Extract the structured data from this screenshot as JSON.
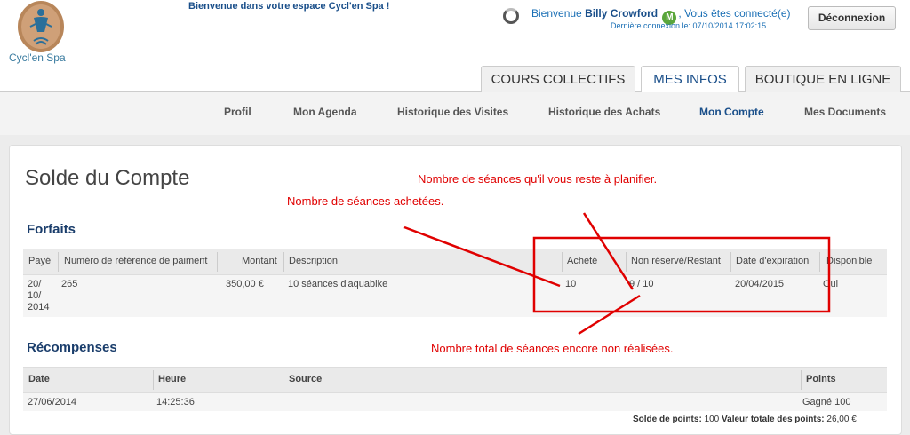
{
  "header": {
    "logo_text": "Cycl'en Spa",
    "welcome_space": "Bienvenue dans votre espace Cycl'en Spa !",
    "welcome_prefix": "Bienvenue",
    "user_name": "Billy Crowford",
    "badge": "M",
    "welcome_suffix": ", Vous êtes connecté(e)",
    "last_login": "Dernière connexion le: 07/10/2014 17:02:15",
    "logout_label": "Déconnexion",
    "tabs": [
      "COURS COLLECTIFS",
      "MES INFOS",
      "BOUTIQUE EN LIGNE"
    ],
    "active_tab": "MES INFOS"
  },
  "subnav": {
    "items": [
      "Profil",
      "Mon Agenda",
      "Historique des Visites",
      "Historique des Achats",
      "Mon Compte",
      "Mes Documents"
    ],
    "active": "Mon Compte"
  },
  "page": {
    "title": "Solde du Compte"
  },
  "forfaits": {
    "title": "Forfaits",
    "columns": [
      "Payé",
      "Numéro de référence de paiment",
      "Montant",
      "Description",
      "Acheté",
      "Non réservé/Restant",
      "Date d'expiration",
      "Disponible"
    ],
    "rows": [
      {
        "paye": "20/ 10/ 2014",
        "paye_lines": [
          "20/",
          "10/",
          "2014"
        ],
        "reference": "265",
        "montant": "350,00 €",
        "description": "10 séances d'aquabike",
        "achete": "10",
        "restant": "9 / 10",
        "expiration": "20/04/2015",
        "disponible": "Oui"
      }
    ]
  },
  "recompenses": {
    "title": "Récompenses",
    "columns": [
      "Date",
      "Heure",
      "Source",
      "Points"
    ],
    "rows": [
      {
        "date": "27/06/2014",
        "heure": "14:25:36",
        "source": "",
        "points": "Gagné 100"
      }
    ],
    "solde_label": "Solde de points:",
    "solde_value": "100",
    "valeur_label": "Valeur totale des points:",
    "valeur_value": "26,00 €"
  },
  "annotations": {
    "remaining_to_plan": "Nombre de séances qu'il vous reste à planifier.",
    "purchased": "Nombre de séances achetées.",
    "total_not_done": "Nombre total de séances encore non réalisées.",
    "color": "#e00000"
  },
  "colors": {
    "brand_blue": "#1a4f8a",
    "badge_green": "#5aa63b"
  }
}
